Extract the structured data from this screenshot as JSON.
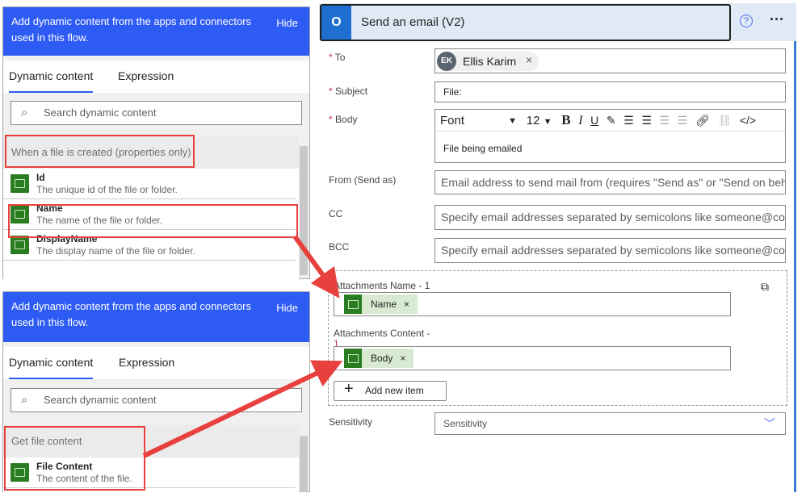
{
  "panel1": {
    "header": "Add dynamic content from the apps and connectors used in this flow.",
    "hide": "Hide",
    "tabs": [
      "Dynamic content",
      "Expression"
    ],
    "search_placeholder": "Search dynamic content",
    "section": "When a file is created (properties only)",
    "items": [
      {
        "name": "Id",
        "desc": "The unique id of the file or folder."
      },
      {
        "name": "Name",
        "desc": "The name of the file or folder."
      },
      {
        "name": "DisplayName",
        "desc": "The display name of the file or folder."
      }
    ]
  },
  "panel2": {
    "header": "Add dynamic content from the apps and connectors used in this flow.",
    "hide": "Hide",
    "tabs": [
      "Dynamic content",
      "Expression"
    ],
    "search_placeholder": "Search dynamic content",
    "section": "Get file content",
    "items": [
      {
        "name": "File Content",
        "desc": "The content of the file."
      }
    ]
  },
  "card": {
    "title": "Send an email (V2)",
    "more": "···",
    "help": "?",
    "to": {
      "label": "To",
      "avatar": "EK",
      "person": "Ellis Karim"
    },
    "subject": {
      "label": "Subject",
      "value": "File:"
    },
    "body": {
      "label": "Body",
      "font": "Font",
      "size": "12",
      "text": "File being emailed"
    },
    "from": {
      "label": "From (Send as)",
      "placeholder": "Email address to send mail from (requires \"Send as\" or \"Send on behalf of\" permission)"
    },
    "cc": {
      "label": "CC",
      "placeholder": "Specify email addresses separated by semicolons like someone@contoso.com"
    },
    "bcc": {
      "label": "BCC",
      "placeholder": "Specify email addresses separated by semicolons like someone@contoso.com"
    },
    "att_name": {
      "label": "Attachments Name - 1",
      "token": "Name"
    },
    "att_content": {
      "label": "Attachments Content -",
      "label2": "1",
      "token": "Body"
    },
    "add_item": "Add new item",
    "sensitivity": {
      "label": "Sensitivity",
      "placeholder": "Sensitivity"
    }
  },
  "colors": {
    "accent": "#2e5bf4",
    "connector": "#2a7c20",
    "annotation": "#e8403d"
  }
}
